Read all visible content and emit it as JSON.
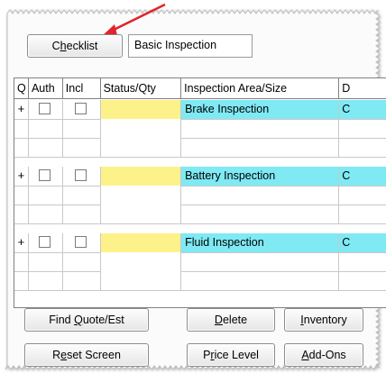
{
  "header": {
    "checklist_button": "Checklist",
    "checklist_mnemonic": "h",
    "checklist_value": "Basic Inspection"
  },
  "grid": {
    "columns": [
      "Q",
      "Auth",
      "Incl",
      "Status/Qty",
      "Inspection Area/Size",
      "D"
    ],
    "rows": [
      {
        "type": "item",
        "q": "+",
        "auth_checked": false,
        "incl_checked": false,
        "status": "",
        "area": "Brake Inspection",
        "d": "C"
      },
      {
        "type": "blank"
      },
      {
        "type": "blank"
      },
      {
        "type": "item",
        "q": "+",
        "auth_checked": false,
        "incl_checked": false,
        "status": "",
        "area": "Battery Inspection",
        "d": "C"
      },
      {
        "type": "blank"
      },
      {
        "type": "blank"
      },
      {
        "type": "item",
        "q": "+",
        "auth_checked": false,
        "incl_checked": false,
        "status": "",
        "area": "Fluid Inspection",
        "d": "C"
      },
      {
        "type": "blank"
      },
      {
        "type": "blank"
      }
    ]
  },
  "buttons": {
    "find_quote": "Find Quote/Est",
    "delete": "Delete",
    "inventory": "Inventory",
    "reset_screen": "Reset Screen",
    "price_level": "Price Level",
    "add_ons": "Add-Ons"
  },
  "colors": {
    "item_highlight": "#7fe9f4",
    "status_highlight": "#fdf28a",
    "arrow": "#e0252b"
  }
}
